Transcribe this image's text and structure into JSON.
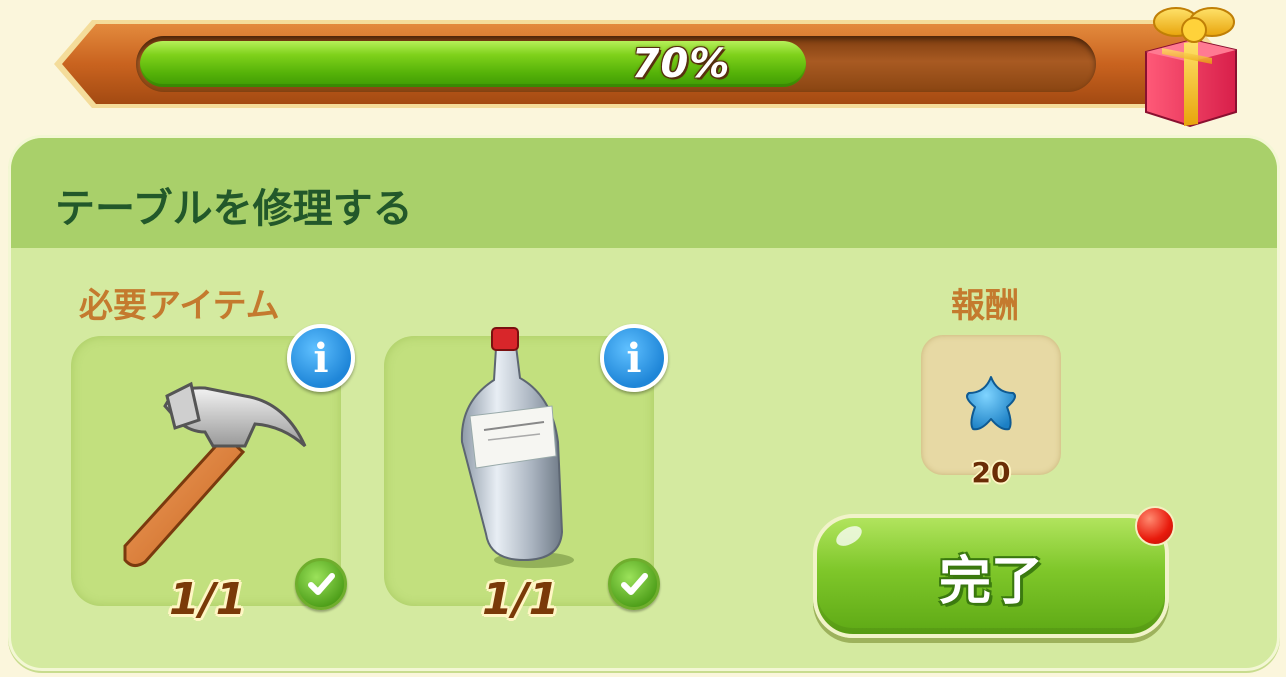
{
  "progress": {
    "value": 0.7,
    "label": "70%"
  },
  "task": {
    "title": "テーブルを修理する"
  },
  "required_items": {
    "label": "必要アイテム",
    "items": [
      {
        "icon": "hammer-icon",
        "count": "1/1",
        "complete": true
      },
      {
        "icon": "turpentine-bottle-icon",
        "count": "1/1",
        "complete": true
      }
    ]
  },
  "reward": {
    "label": "報酬",
    "icon": "blue-star-icon",
    "amount": "20"
  },
  "complete_button": {
    "label": "完了",
    "has_notification": true
  },
  "colors": {
    "panel_background": "#d4eaa0",
    "header_background": "#a9d06a",
    "title_text": "#22582a",
    "section_label": "#c47a2e",
    "progress_fill": "#7fd11b",
    "button_green": "#7fc72a"
  }
}
